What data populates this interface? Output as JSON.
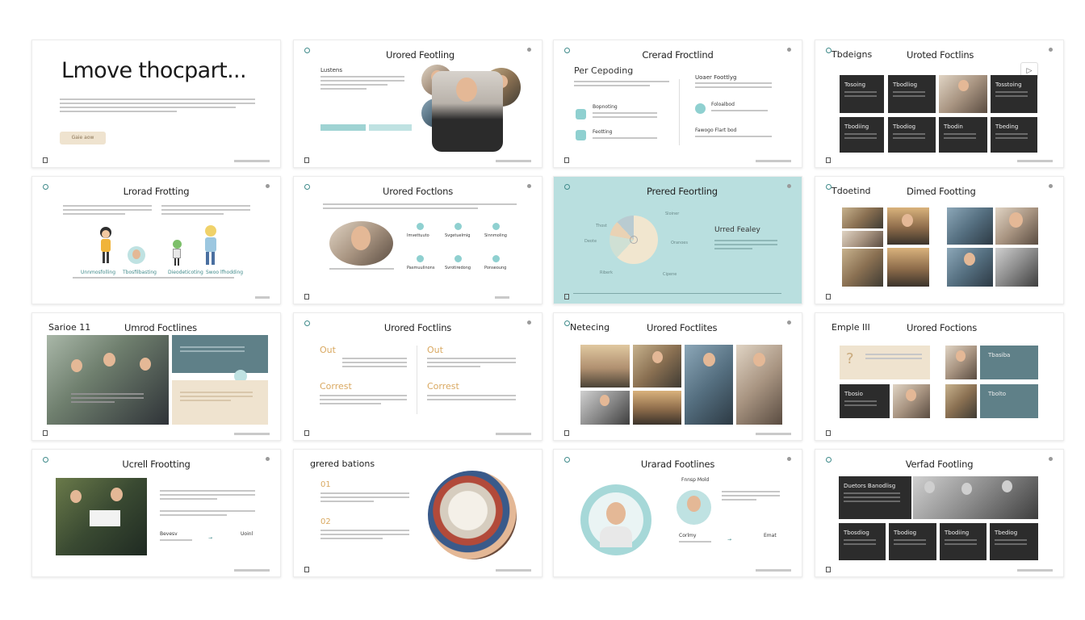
{
  "slides": [
    {
      "title": "Lmove thocpart...",
      "button": "Gaie aow"
    },
    {
      "title": "Urored Feotling",
      "label": "Lustens"
    },
    {
      "title": "Crerad Froctlind",
      "subtitle": "Per Cepoding",
      "col_title": "Uoaer Foottlyg",
      "items": [
        "Bopnoting",
        "Feotting",
        "Foloalbod",
        "Fawogo Flart bod"
      ]
    },
    {
      "title": "Uroted Foctlins",
      "left_title": "Tbdeigns",
      "tiles": [
        "Tosoing",
        "Tbodliog",
        "Tosstoing",
        "Tbodiing",
        "Tbodiog",
        "Tbodin",
        "Tbeding"
      ]
    },
    {
      "title": "Lrorad Frotting",
      "labels": [
        "Unnmosfolling",
        "Tbosfilbasting",
        "Dieodeticoting",
        "Swoo lfhodding"
      ]
    },
    {
      "title": "Urored Foctlons",
      "items": [
        "Imvettuuto",
        "Svgetuelmig",
        "Sinnmoling",
        "Pasmuulinons",
        "Svrotiredong",
        "Ponseoung"
      ]
    },
    {
      "title": "Prered Feortling",
      "side_title": "Urred Fealey",
      "pie_labels": [
        "Sloiner",
        "Deote",
        "Oranoes",
        "Thost",
        "Riberk",
        "Cipene"
      ]
    },
    {
      "title": "Dimed Footting",
      "left_title": "Tdoetind"
    },
    {
      "title": "Umrod Foctlines",
      "left_title": "Sarioe 11"
    },
    {
      "title": "Urored Foctlins",
      "labels": [
        "Out",
        "Out",
        "Correst",
        "Correst"
      ]
    },
    {
      "title": "Urored Foctlites",
      "left_title": "Netecing"
    },
    {
      "title": "Urored Foctions",
      "left_title": "Emple III",
      "tiles": [
        "Tbasiba",
        "Tbosio",
        "Tbolto",
        "Tbospho"
      ]
    },
    {
      "title": "Ucrell Frootting",
      "labels": [
        "Bevesv",
        "Uoinl"
      ]
    },
    {
      "title": "grered bations",
      "labels": [
        "01",
        "02"
      ]
    },
    {
      "title": "Urarad Footlines",
      "labels": [
        "Fnnsp Mold",
        "Corlmy",
        "Emat"
      ]
    },
    {
      "title": "Verfad Footling",
      "header_tile": "Duetors Banodlisg",
      "tiles": [
        "Tbosdiog",
        "Tbodiog",
        "Tbodiing",
        "Tbediog"
      ]
    }
  ],
  "colors": {
    "teal": "#b9dfdf",
    "accent": "#8fd0d0",
    "dark_tile": "#2c2c2c",
    "beige": "#efe3cf",
    "slate": "#5f8088"
  }
}
